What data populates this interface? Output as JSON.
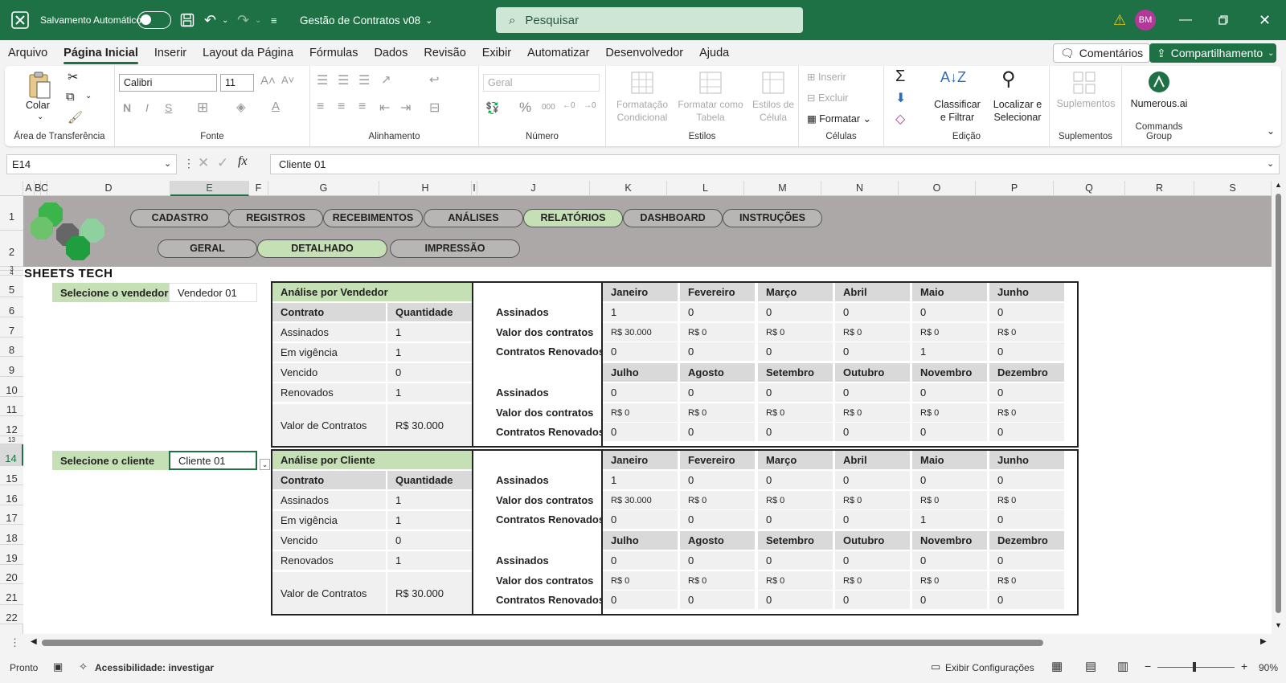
{
  "titlebar": {
    "autosave_label": "Salvamento Automático",
    "doc_title": "Gestão de Contratos v08",
    "search_placeholder": "Pesquisar",
    "user_initials": "BM"
  },
  "menu": [
    "Arquivo",
    "Página Inicial",
    "Inserir",
    "Layout da Página",
    "Fórmulas",
    "Dados",
    "Revisão",
    "Exibir",
    "Automatizar",
    "Desenvolvedor",
    "Ajuda"
  ],
  "menu_active": "Página Inicial",
  "comments_label": "Comentários",
  "share_label": "Compartilhamento",
  "ribbon": {
    "paste_label": "Colar",
    "clipboard_label": "Área de Transferência",
    "font_name": "Calibri",
    "font_size": "11",
    "font_label": "Fonte",
    "alignment_label": "Alinhamento",
    "number_format": "Geral",
    "number_label": "Número",
    "cond_format": "Formatação Condicional",
    "format_table": "Formatar como Tabela",
    "cell_styles": "Estilos de Célula",
    "styles_label": "Estilos",
    "insert": "Inserir",
    "delete": "Excluir",
    "format": "Formatar",
    "cells_label": "Células",
    "sort_filter": "Classificar e Filtrar",
    "find_select": "Localizar e Selecionar",
    "editing_label": "Edição",
    "addins": "Suplementos",
    "addins_label": "Suplementos",
    "numerous": "Numerous.ai",
    "commands_label": "Commands Group"
  },
  "formula_bar": {
    "name_box": "E14",
    "fx": "fx",
    "content": "Cliente 01"
  },
  "columns": [
    "A",
    "B",
    "C",
    "D",
    "E",
    "F",
    "G",
    "H",
    "I",
    "J",
    "K",
    "L",
    "M",
    "N",
    "O",
    "P",
    "Q",
    "R",
    "S"
  ],
  "rows": [
    "1",
    "2",
    "3",
    "4",
    "5",
    "6",
    "7",
    "8",
    "9",
    "10",
    "11",
    "12",
    "13",
    "14",
    "15",
    "16",
    "17",
    "18",
    "19",
    "20",
    "21",
    "22"
  ],
  "logo_text": "SHEETS TECH",
  "nav_primary": [
    "CADASTRO",
    "REGISTROS",
    "RECEBIMENTOS",
    "ANÁLISES",
    "RELATÓRIOS",
    "DASHBOARD",
    "INSTRUÇÕES"
  ],
  "nav_secondary": [
    "GERAL",
    "DETALHADO",
    "IMPRESSÃO"
  ],
  "sections": [
    {
      "select_label": "Selecione o vendedor",
      "select_value": "Vendedor 01",
      "title": "Análise por Vendedor",
      "col_contrato": "Contrato",
      "col_quantidade": "Quantidade",
      "rows": [
        [
          "Assinados",
          "1"
        ],
        [
          "Em vigência",
          "1"
        ],
        [
          "Vencido",
          "0"
        ],
        [
          "Renovados",
          "1"
        ]
      ],
      "valor_label": "Valor de Contratos",
      "valor_value": "R$ 30.000",
      "metrics": [
        "Assinados",
        "Valor dos contratos",
        "Contratos Renovados"
      ],
      "months1": [
        "Janeiro",
        "Fevereiro",
        "Março",
        "Abril",
        "Maio",
        "Junho"
      ],
      "data1": [
        [
          "1",
          "0",
          "0",
          "0",
          "0",
          "0"
        ],
        [
          "R$ 30.000",
          "R$ 0",
          "R$ 0",
          "R$ 0",
          "R$ 0",
          "R$ 0"
        ],
        [
          "0",
          "0",
          "0",
          "0",
          "1",
          "0"
        ]
      ],
      "months2": [
        "Julho",
        "Agosto",
        "Setembro",
        "Outubro",
        "Novembro",
        "Dezembro"
      ],
      "data2": [
        [
          "0",
          "0",
          "0",
          "0",
          "0",
          "0"
        ],
        [
          "R$ 0",
          "R$ 0",
          "R$ 0",
          "R$ 0",
          "R$ 0",
          "R$ 0"
        ],
        [
          "0",
          "0",
          "0",
          "0",
          "0",
          "0"
        ]
      ]
    },
    {
      "select_label": "Selecione o cliente",
      "select_value": "Cliente 01",
      "title": "Análise por Cliente",
      "col_contrato": "Contrato",
      "col_quantidade": "Quantidade",
      "rows": [
        [
          "Assinados",
          "1"
        ],
        [
          "Em vigência",
          "1"
        ],
        [
          "Vencido",
          "0"
        ],
        [
          "Renovados",
          "1"
        ]
      ],
      "valor_label": "Valor de Contratos",
      "valor_value": "R$ 30.000",
      "metrics": [
        "Assinados",
        "Valor dos contratos",
        "Contratos Renovados"
      ],
      "months1": [
        "Janeiro",
        "Fevereiro",
        "Março",
        "Abril",
        "Maio",
        "Junho"
      ],
      "data1": [
        [
          "1",
          "0",
          "0",
          "0",
          "0",
          "0"
        ],
        [
          "R$ 30.000",
          "R$ 0",
          "R$ 0",
          "R$ 0",
          "R$ 0",
          "R$ 0"
        ],
        [
          "0",
          "0",
          "0",
          "0",
          "1",
          "0"
        ]
      ],
      "months2": [
        "Julho",
        "Agosto",
        "Setembro",
        "Outubro",
        "Novembro",
        "Dezembro"
      ],
      "data2": [
        [
          "0",
          "0",
          "0",
          "0",
          "0",
          "0"
        ],
        [
          "R$ 0",
          "R$ 0",
          "R$ 0",
          "R$ 0",
          "R$ 0",
          "R$ 0"
        ],
        [
          "0",
          "0",
          "0",
          "0",
          "0",
          "0"
        ]
      ]
    }
  ],
  "status": {
    "ready": "Pronto",
    "accessibility": "Acessibilidade: investigar",
    "display_settings": "Exibir Configurações",
    "zoom": "90%"
  },
  "colors": {
    "excel_green": "#1e7145",
    "banner_gray": "#aca8a8",
    "pill_active": "#c5e0b4"
  }
}
